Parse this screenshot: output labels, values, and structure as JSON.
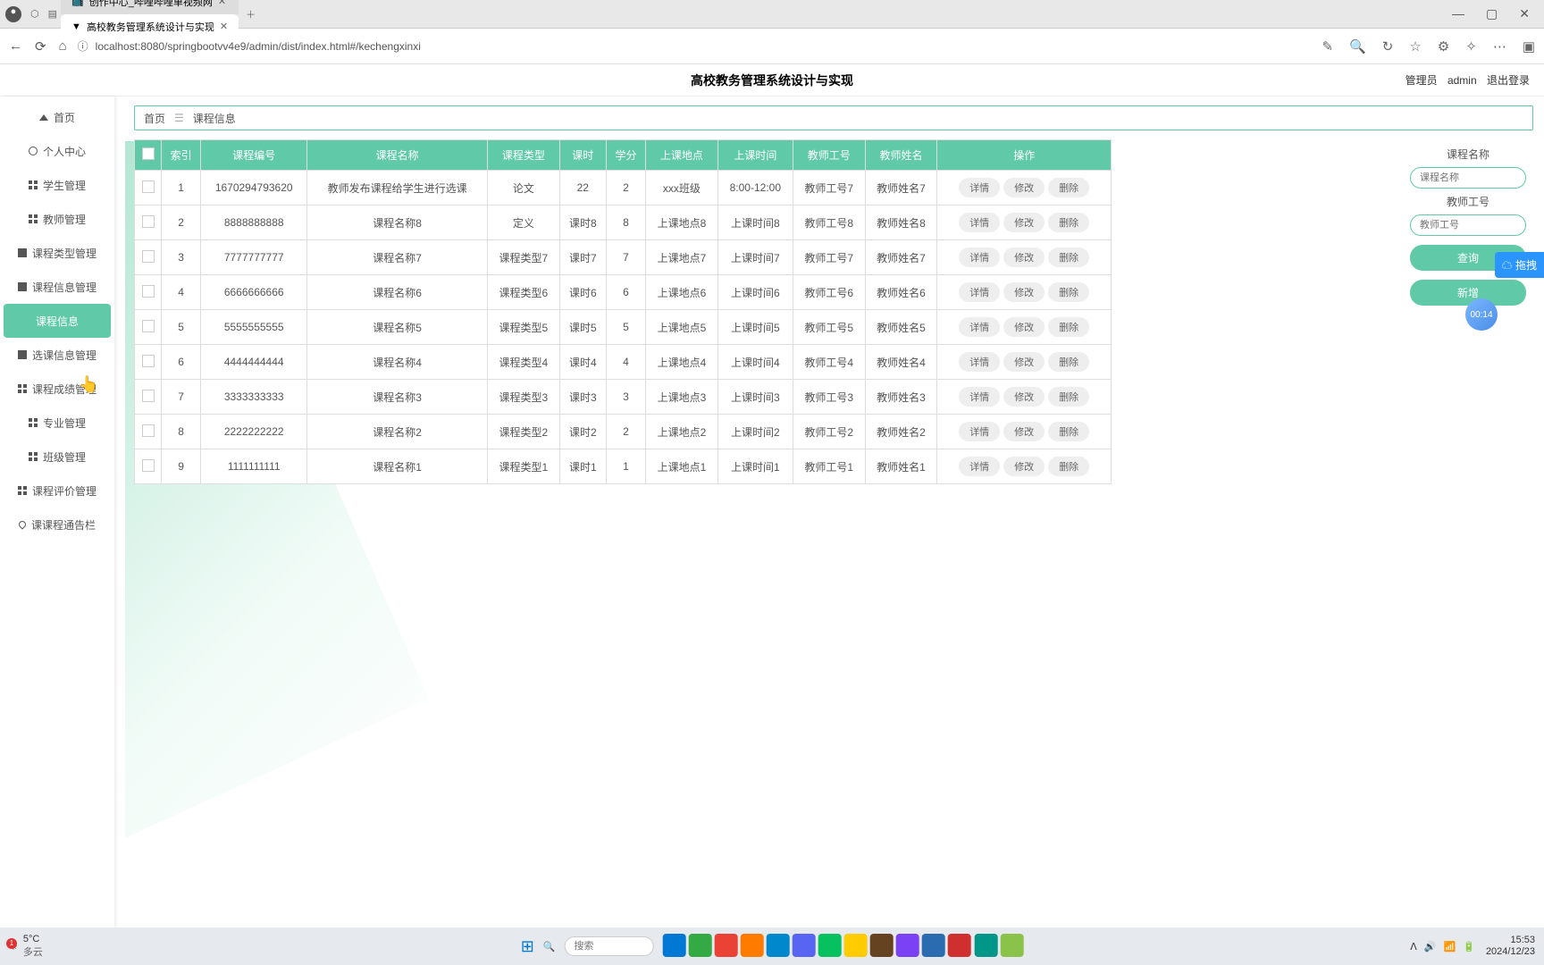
{
  "browser": {
    "tabs": [
      {
        "favicon": "📺",
        "title": "创作中心_哔哩哔哩单视频网",
        "active": false
      },
      {
        "favicon": "▼",
        "title": "高校教务管理系统设计与实现",
        "active": true
      }
    ],
    "win_min": "—",
    "win_max": "▢",
    "win_close": "✕",
    "nav_back": "←",
    "nav_refresh": "⟳",
    "nav_home": "⌂",
    "url_proto": "ⓘ",
    "url": "localhost:8080/springbootvv4e9/admin/dist/index.html#/kechengxinxi",
    "tool_icons": [
      "✎",
      "🔍",
      "↻",
      "☆",
      "⚙",
      "✧",
      "⋯",
      "▣"
    ]
  },
  "header": {
    "title": "高校教务管理系统设计与实现",
    "role": "管理员",
    "user": "admin",
    "logout": "退出登录"
  },
  "sidebar": [
    {
      "label": "首页",
      "icon": "home"
    },
    {
      "label": "个人中心",
      "icon": "user"
    },
    {
      "label": "学生管理",
      "icon": "grid"
    },
    {
      "label": "教师管理",
      "icon": "grid"
    },
    {
      "label": "课程类型管理",
      "icon": "square"
    },
    {
      "label": "课程信息管理",
      "icon": "square"
    },
    {
      "label": "课程信息",
      "icon": "",
      "active": true
    },
    {
      "label": "选课信息管理",
      "icon": "square"
    },
    {
      "label": "课程成绩管理",
      "icon": "grid"
    },
    {
      "label": "专业管理",
      "icon": "grid"
    },
    {
      "label": "班级管理",
      "icon": "grid"
    },
    {
      "label": "课程评价管理",
      "icon": "grid"
    },
    {
      "label": "课课程通告栏",
      "icon": "pin"
    }
  ],
  "breadcrumb": {
    "home": "首页",
    "sep": "☰",
    "current": "课程信息"
  },
  "table": {
    "headers": [
      "",
      "索引",
      "课程编号",
      "课程名称",
      "课程类型",
      "课时",
      "学分",
      "上课地点",
      "上课时间",
      "教师工号",
      "教师姓名",
      "操作"
    ],
    "action_labels": {
      "detail": "详情",
      "edit": "修改",
      "delete": "删除"
    },
    "rows": [
      {
        "idx": "1",
        "no": "1670294793620",
        "name": "教师发布课程给学生进行选课",
        "type": "论文",
        "hours": "22",
        "credit": "2",
        "place": "xxx班级",
        "time": "8:00-12:00",
        "tid": "教师工号7",
        "tname": "教师姓名7"
      },
      {
        "idx": "2",
        "no": "8888888888",
        "name": "课程名称8",
        "type": "定义",
        "hours": "课时8",
        "credit": "8",
        "place": "上课地点8",
        "time": "上课时间8",
        "tid": "教师工号8",
        "tname": "教师姓名8"
      },
      {
        "idx": "3",
        "no": "7777777777",
        "name": "课程名称7",
        "type": "课程类型7",
        "hours": "课时7",
        "credit": "7",
        "place": "上课地点7",
        "time": "上课时间7",
        "tid": "教师工号7",
        "tname": "教师姓名7"
      },
      {
        "idx": "4",
        "no": "6666666666",
        "name": "课程名称6",
        "type": "课程类型6",
        "hours": "课时6",
        "credit": "6",
        "place": "上课地点6",
        "time": "上课时间6",
        "tid": "教师工号6",
        "tname": "教师姓名6"
      },
      {
        "idx": "5",
        "no": "5555555555",
        "name": "课程名称5",
        "type": "课程类型5",
        "hours": "课时5",
        "credit": "5",
        "place": "上课地点5",
        "time": "上课时间5",
        "tid": "教师工号5",
        "tname": "教师姓名5"
      },
      {
        "idx": "6",
        "no": "4444444444",
        "name": "课程名称4",
        "type": "课程类型4",
        "hours": "课时4",
        "credit": "4",
        "place": "上课地点4",
        "time": "上课时间4",
        "tid": "教师工号4",
        "tname": "教师姓名4"
      },
      {
        "idx": "7",
        "no": "3333333333",
        "name": "课程名称3",
        "type": "课程类型3",
        "hours": "课时3",
        "credit": "3",
        "place": "上课地点3",
        "time": "上课时间3",
        "tid": "教师工号3",
        "tname": "教师姓名3"
      },
      {
        "idx": "8",
        "no": "2222222222",
        "name": "课程名称2",
        "type": "课程类型2",
        "hours": "课时2",
        "credit": "2",
        "place": "上课地点2",
        "time": "上课时间2",
        "tid": "教师工号2",
        "tname": "教师姓名2"
      },
      {
        "idx": "9",
        "no": "1111111111",
        "name": "课程名称1",
        "type": "课程类型1",
        "hours": "课时1",
        "credit": "1",
        "place": "上课地点1",
        "time": "上课时间1",
        "tid": "教师工号1",
        "tname": "教师姓名1"
      }
    ]
  },
  "filters": {
    "lbl1": "课程名称",
    "ph1": "课程名称",
    "lbl2": "教师工号",
    "ph2": "教师工号",
    "btn1": "查询",
    "btn2": "新增"
  },
  "float": {
    "drag": "拖拽",
    "timer": "00:14"
  },
  "taskbar": {
    "temp_badge": "1",
    "temp": "5°C",
    "weather": "多云",
    "search_ph": "搜索",
    "apps": [
      "#0078d4",
      "#33aa44",
      "#ea4335",
      "#ff7b00",
      "#0088cc",
      "#5865f2",
      "#07c160",
      "#ffcc00",
      "#654321",
      "#7a42f4",
      "#2b6cb0",
      "#d02f2f",
      "#009688",
      "#8bc34a"
    ],
    "tray": [
      "ᐱ",
      "🔊",
      "📶",
      "🔋"
    ],
    "time": "15:53",
    "date": "2024/12/23"
  }
}
